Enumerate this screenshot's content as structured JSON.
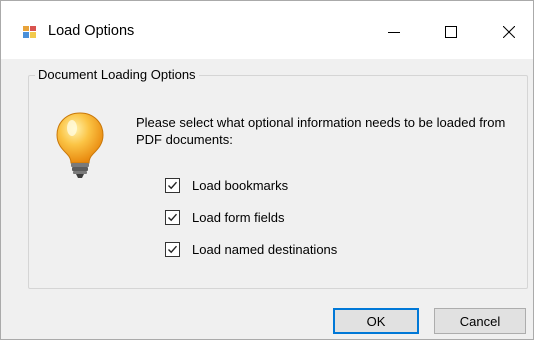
{
  "window": {
    "title": "Load Options",
    "controls": {
      "minimize_icon": "minimize-icon",
      "maximize_icon": "maximize-icon",
      "close_icon": "close-icon"
    }
  },
  "group": {
    "legend": "Document Loading Options",
    "icon": "lightbulb-icon",
    "prompt": "Please select what optional information needs to be loaded from PDF documents:"
  },
  "options": [
    {
      "label": "Load bookmarks",
      "checked": true
    },
    {
      "label": "Load form fields",
      "checked": true
    },
    {
      "label": "Load named destinations",
      "checked": true
    }
  ],
  "buttons": {
    "ok": "OK",
    "cancel": "Cancel"
  },
  "colors": {
    "accent": "#0078d7",
    "bulb": "#f7a21b"
  }
}
